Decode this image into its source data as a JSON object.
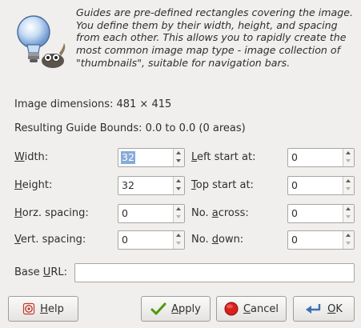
{
  "description": "Guides are pre-defined rectangles covering the image. You define them by their width, height, and spacing from each other. This allows you to rapidly create the most common image map type - image collection of \"thumbnails\", suitable for navigation bars.",
  "image_dimensions": "Image dimensions: 481 × 415",
  "guide_bounds": "Resulting Guide Bounds: 0.0 to 0.0 (0 areas)",
  "fields": {
    "width": {
      "label_u": "W",
      "label_rest": "idth:",
      "value": "32"
    },
    "height": {
      "label_u": "H",
      "label_rest": "eight:",
      "value": "32"
    },
    "horz": {
      "label_u": "H",
      "label_rest": "orz. spacing:",
      "value": "0"
    },
    "vert": {
      "label_u": "V",
      "label_rest": "ert. spacing:",
      "value": "0"
    },
    "left_start": {
      "label_u": "L",
      "label_rest": "eft start at:",
      "value": "0"
    },
    "top_start": {
      "label_u": "T",
      "label_rest": "op start at:",
      "value": "0"
    },
    "no_across": {
      "label_pre": "No. ",
      "label_u": "a",
      "label_rest": "cross:",
      "value": "0"
    },
    "no_down": {
      "label_pre": "No. ",
      "label_u": "d",
      "label_rest": "own:",
      "value": "0"
    }
  },
  "base_url": {
    "label_pre": "Base ",
    "label_u": "U",
    "label_rest": "RL:",
    "value": ""
  },
  "buttons": {
    "help": {
      "label_u": "H",
      "label_rest": "elp"
    },
    "apply": {
      "label_u": "A",
      "label_rest": "pply"
    },
    "cancel": {
      "label_u": "C",
      "label_rest": "ancel"
    },
    "ok": {
      "label_u": "O",
      "label_rest": "K"
    }
  },
  "icons": {
    "header": "lightbulb-wilber-icon",
    "help": "help-icon",
    "apply": "check-icon",
    "cancel": "stop-icon",
    "ok": "enter-arrow-icon"
  }
}
